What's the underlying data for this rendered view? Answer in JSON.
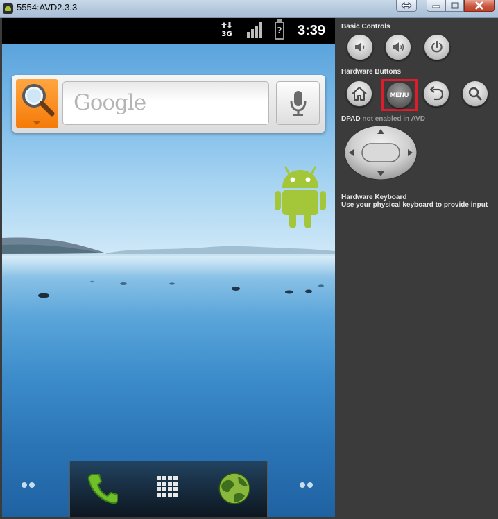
{
  "window": {
    "title": "5554:AVD2.3.3"
  },
  "status_bar": {
    "data_type": "3G",
    "battery_state": "?",
    "time": "3:39"
  },
  "search_widget": {
    "placeholder": "Google"
  },
  "control_panel": {
    "basic_controls_label": "Basic Controls",
    "hardware_buttons_label": "Hardware Buttons",
    "menu_button_label": "MENU",
    "dpad_label": "DPAD",
    "dpad_status": "not enabled in AVD",
    "keyboard_title": "Hardware Keyboard",
    "keyboard_hint": "Use your physical keyboard to provide input"
  },
  "colors": {
    "menu_highlight": "#dd1c2c",
    "search_source_orange": "#f57a08",
    "android_green": "#a4c639",
    "panel_background": "#3b3b3b"
  },
  "icons": {
    "basic_controls": [
      "volume-down-icon",
      "volume-up-icon",
      "power-icon"
    ],
    "hardware_buttons": [
      "home-icon",
      "menu-button",
      "back-icon",
      "search-icon"
    ],
    "dock": [
      "phone-icon",
      "app-launcher-icon",
      "browser-globe-icon"
    ]
  }
}
